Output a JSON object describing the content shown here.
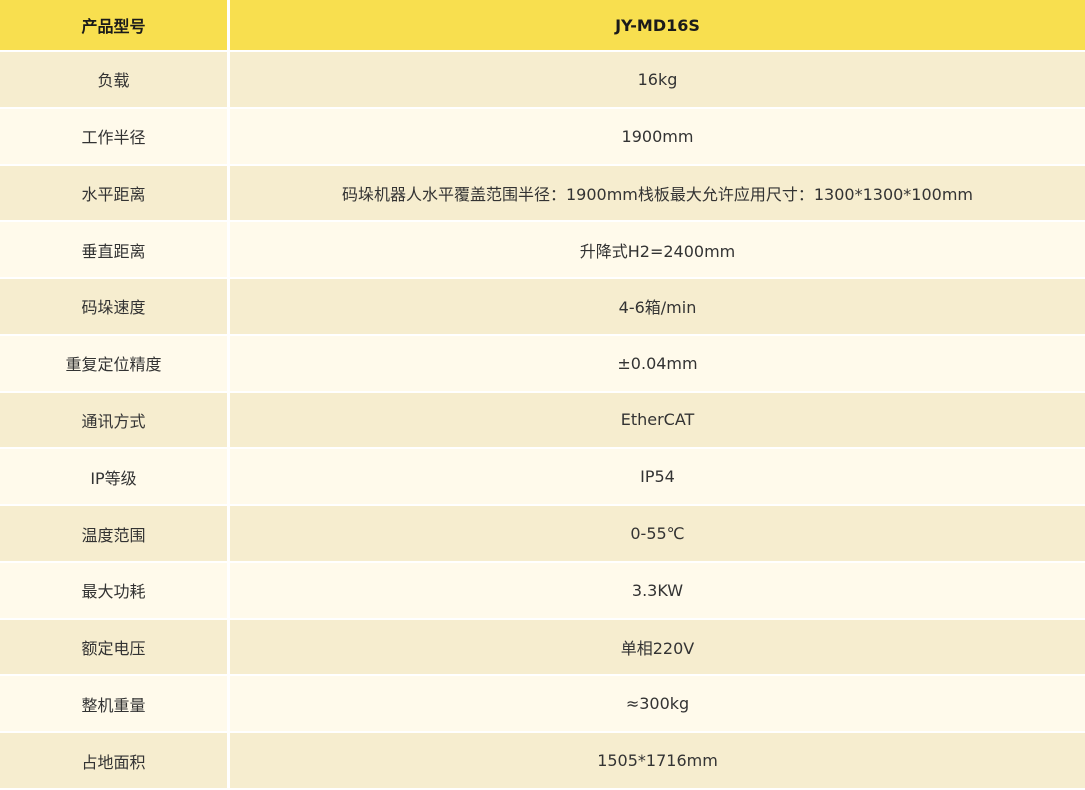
{
  "header": {
    "label": "产品型号",
    "value": "JY-MD16S"
  },
  "rows": [
    {
      "label": "负载",
      "value": "16kg"
    },
    {
      "label": "工作半径",
      "value": "1900mm"
    },
    {
      "label": "水平距离",
      "value": "码垛机器人水平覆盖范围半径：1900mm栈板最大允许应用尺寸：1300*1300*100mm"
    },
    {
      "label": "垂直距离",
      "value": "升降式H2=2400mm"
    },
    {
      "label": "码垛速度",
      "value": "4-6箱/min"
    },
    {
      "label": "重复定位精度",
      "value": "±0.04mm"
    },
    {
      "label": "通讯方式",
      "value": "EtherCAT"
    },
    {
      "label": "IP等级",
      "value": "IP54"
    },
    {
      "label": "温度范围",
      "value": "0-55℃"
    },
    {
      "label": "最大功耗",
      "value": "3.3KW"
    },
    {
      "label": "额定电压",
      "value": "单相220V"
    },
    {
      "label": "整机重量",
      "value": "≈300kg"
    },
    {
      "label": "占地面积",
      "value": "1505*1716mm"
    }
  ],
  "colors": {
    "header_bg": "#f8df4f",
    "row_odd_bg": "#f6edcf",
    "row_even_bg": "#fffaeb"
  }
}
